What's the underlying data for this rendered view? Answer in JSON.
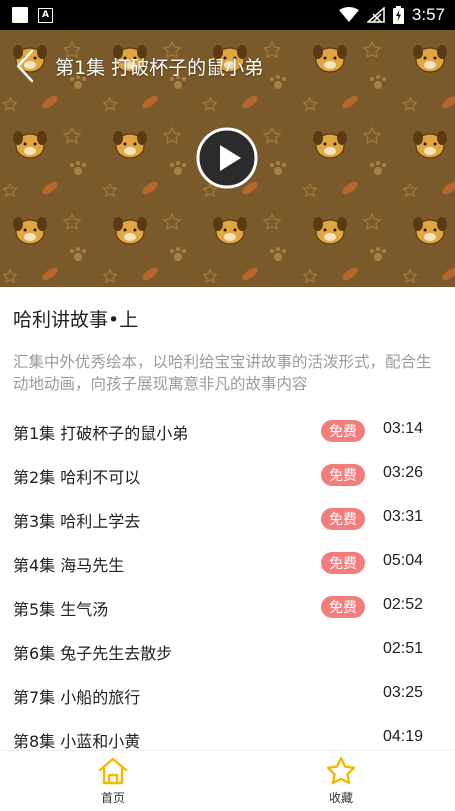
{
  "status_bar": {
    "time": "3:57"
  },
  "player": {
    "title": "第1集 打破杯子的鼠小弟",
    "background_color": "#7a5a2a",
    "icons": {
      "back": "chevron-left-icon",
      "play": "play-icon"
    }
  },
  "album": {
    "title": "哈利讲故事•上",
    "description": "汇集中外优秀绘本，以哈利给宝宝讲故事的活泼形式，配合生动地动画，向孩子展现寓意非凡的故事内容"
  },
  "episodes": [
    {
      "title": "第1集 打破杯子的鼠小弟",
      "badge": "免费",
      "duration": "03:14"
    },
    {
      "title": "第2集 哈利不可以",
      "badge": "免费",
      "duration": "03:26"
    },
    {
      "title": "第3集 哈利上学去",
      "badge": "免费",
      "duration": "03:31"
    },
    {
      "title": "第4集 海马先生",
      "badge": "免费",
      "duration": "05:04"
    },
    {
      "title": "第5集 生气汤",
      "badge": "免费",
      "duration": "02:52"
    },
    {
      "title": "第6集 兔子先生去散步",
      "badge": "",
      "duration": "02:51"
    },
    {
      "title": "第7集 小船的旅行",
      "badge": "",
      "duration": "03:25"
    },
    {
      "title": "第8集 小蓝和小黄",
      "badge": "",
      "duration": "04:19"
    }
  ],
  "nav": {
    "home_label": "首页",
    "favorites_label": "收藏",
    "accent_color": "#f5b800",
    "icons": {
      "home": "home-icon",
      "favorites": "star-icon"
    }
  },
  "colors": {
    "free_badge": "#f37d7d",
    "description": "#9b9b9b"
  }
}
